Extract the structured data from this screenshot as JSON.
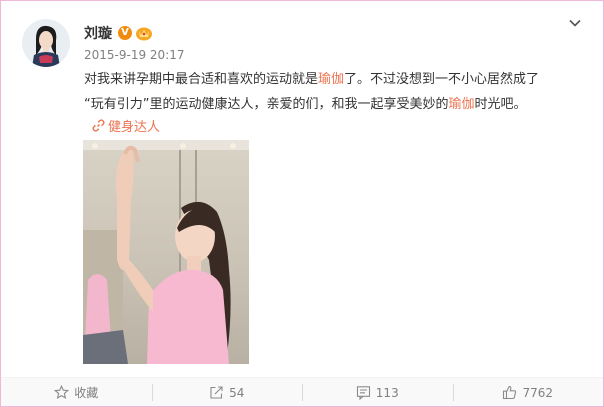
{
  "post": {
    "username": "刘璇",
    "verified_badge": "V",
    "member_badge_icon": "crown-icon",
    "timestamp": "2015-9-19 20:17",
    "text": {
      "seg1": "对我来讲孕期中最合适和喜欢的运动就是",
      "hl1": "瑜伽",
      "seg2": "了。不过没想到一不小心居然成了",
      "seg3": "“玩有引力”里的运动健康达人，亲爱的们，和我一起享受美妙的",
      "hl2": "瑜伽",
      "seg4": "时光吧。"
    },
    "topic": {
      "icon": "link-icon",
      "label": "健身达人"
    },
    "image_alt": "yoga-photo"
  },
  "footer": {
    "favorite": {
      "icon": "star-icon",
      "label": "收藏"
    },
    "repost": {
      "icon": "repost-icon",
      "count": "54"
    },
    "comment": {
      "icon": "comment-icon",
      "count": "113"
    },
    "like": {
      "icon": "thumbs-up-icon",
      "count": "7762"
    }
  },
  "colors": {
    "highlight": "#eb7350",
    "text": "#333333",
    "muted": "#808080",
    "border": "#f0b8d8"
  }
}
